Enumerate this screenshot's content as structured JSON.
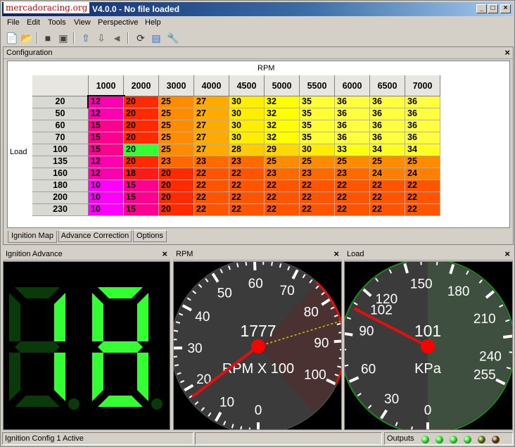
{
  "watermark": "mercadoracing.org",
  "window": {
    "title": "V4.0.0 - No file loaded",
    "controls": [
      "_",
      "□",
      "×"
    ]
  },
  "menu": [
    "File",
    "Edit",
    "Tools",
    "View",
    "Perspective",
    "Help"
  ],
  "toolbar_icons": [
    "new-file-icon",
    "open-folder-icon",
    "save-icon",
    "save-as-icon",
    "upload-icon",
    "download-icon",
    "burn-icon",
    "refresh-icon",
    "chart-icon",
    "wrench-icon"
  ],
  "config": {
    "title": "Configuration",
    "close": "×",
    "x_axis_label": "RPM",
    "y_axis_label": "Load",
    "rpm": [
      "1000",
      "2000",
      "3000",
      "4000",
      "4500",
      "5000",
      "5500",
      "6000",
      "6500",
      "7000"
    ],
    "load": [
      "20",
      "50",
      "60",
      "70",
      "100",
      "135",
      "160",
      "180",
      "200",
      "230"
    ],
    "rows": [
      [
        "12",
        "20",
        "25",
        "27",
        "30",
        "32",
        "35",
        "36",
        "36",
        "36"
      ],
      [
        "12",
        "20",
        "25",
        "27",
        "30",
        "32",
        "35",
        "36",
        "36",
        "36"
      ],
      [
        "15",
        "20",
        "25",
        "27",
        "30",
        "32",
        "35",
        "36",
        "36",
        "36"
      ],
      [
        "15",
        "20",
        "25",
        "27",
        "30",
        "32",
        "35",
        "36",
        "36",
        "36"
      ],
      [
        "15",
        "20",
        "25",
        "27",
        "28",
        "29",
        "30",
        "33",
        "34",
        "34"
      ],
      [
        "12",
        "20",
        "23",
        "23",
        "23",
        "25",
        "25",
        "25",
        "25",
        "25"
      ],
      [
        "12",
        "18",
        "20",
        "22",
        "22",
        "23",
        "23",
        "23",
        "24",
        "24"
      ],
      [
        "10",
        "15",
        "20",
        "22",
        "22",
        "22",
        "22",
        "22",
        "22",
        "22"
      ],
      [
        "10",
        "15",
        "20",
        "22",
        "22",
        "22",
        "22",
        "22",
        "22",
        "22"
      ],
      [
        "10",
        "15",
        "20",
        "22",
        "22",
        "22",
        "22",
        "22",
        "22",
        "22"
      ]
    ],
    "colors": {
      "10": "#ff00ff",
      "12": "#ff00b0",
      "15": "#ff0090",
      "18": "#ff1a1a",
      "20": "#ff2a00",
      "22": "#ff5500",
      "23": "#ff6a00",
      "24": "#ff7f00",
      "25": "#ff8c00",
      "27": "#ffaa00",
      "28": "#ffcc00",
      "29": "#ffd800",
      "30": "#ffee00",
      "32": "#ffff00",
      "33": "#ffff10",
      "34": "#ffff20",
      "35": "#ffff33",
      "36": "#ffff40",
      "highlight": "#33ff33"
    },
    "tabs": [
      "Ignition Map",
      "Advance Correction",
      "Options"
    ]
  },
  "panels": {
    "ignition": {
      "title": "Ignition Advance",
      "value": "18",
      "color": "#33ff33"
    },
    "rpm": {
      "title": "RPM",
      "value": "1777",
      "unit": "RPM X 100",
      "ticks": [
        "0",
        "10",
        "20",
        "30",
        "40",
        "50",
        "60",
        "70",
        "80",
        "90",
        "100"
      ],
      "needle": 17.77,
      "max": 100,
      "redline_from": 75
    },
    "load": {
      "title": "Load",
      "value": "101",
      "unit": "KPa",
      "ticks": [
        "0",
        "30",
        "60",
        "90",
        "120",
        "150",
        "180",
        "210",
        "240",
        "255"
      ],
      "tick_values": [
        0,
        30,
        60,
        90,
        120,
        150,
        180,
        210,
        240,
        255
      ],
      "needle": 101,
      "peak_label": "102",
      "max": 255
    }
  },
  "status": {
    "text": "Ignition Config 1 Active",
    "outputs_label": "Outputs",
    "leds": [
      "#22dd22",
      "#22dd22",
      "#22dd22",
      "#22dd22",
      "#556600",
      "#553300"
    ]
  }
}
